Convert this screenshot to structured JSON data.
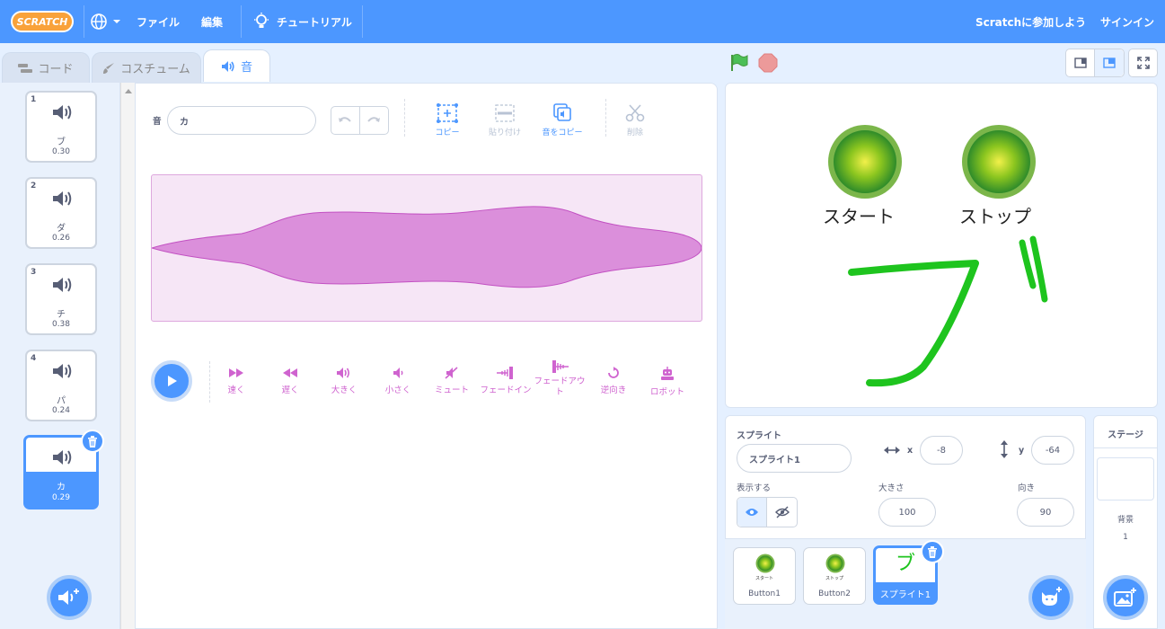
{
  "menubar": {
    "logo": "SCRATCH",
    "file": "ファイル",
    "edit": "編集",
    "tutorials": "チュートリアル",
    "join": "Scratchに参加しよう",
    "signin": "サインイン"
  },
  "tabs": {
    "code": "コード",
    "costumes": "コスチューム",
    "sounds": "音"
  },
  "sounds": [
    {
      "num": "1",
      "name": "ブ",
      "duration": "0.30"
    },
    {
      "num": "2",
      "name": "ダ",
      "duration": "0.26"
    },
    {
      "num": "3",
      "name": "チ",
      "duration": "0.38"
    },
    {
      "num": "4",
      "name": "パ",
      "duration": "0.24"
    },
    {
      "num": "5",
      "name": "カ",
      "duration": "0.29"
    }
  ],
  "editor": {
    "sound_label": "音",
    "sound_name": "カ",
    "tools": {
      "copy": "コピー",
      "paste": "貼り付け",
      "copy_new": "音をコピー",
      "delete": "削除"
    },
    "effects": {
      "faster": "速く",
      "slower": "遅く",
      "louder": "大きく",
      "softer": "小さく",
      "mute": "ミュート",
      "fade_in": "フェードイン",
      "fade_out": "フェードアウト",
      "reverse": "逆向き",
      "robot": "ロボット"
    }
  },
  "stage": {
    "start_label": "スタート",
    "stop_label": "ストップ",
    "drawn_text": "ブ"
  },
  "sprite_info": {
    "sprite_label": "スプライト",
    "sprite_name": "スプライト1",
    "x_label": "x",
    "x": "-8",
    "y_label": "y",
    "y": "-64",
    "show_label": "表示する",
    "size_label": "大きさ",
    "size": "100",
    "direction_label": "向き",
    "direction": "90"
  },
  "sprites": [
    {
      "name": "Button1",
      "caption": "スタート"
    },
    {
      "name": "Button2",
      "caption": "ストップ"
    },
    {
      "name": "スプライト1",
      "caption": "ブ"
    }
  ],
  "stage_panel": {
    "title": "ステージ",
    "backdrops_label": "背景",
    "backdrops_count": "1"
  },
  "colors": {
    "primary": "#4c97ff",
    "sound": "#cf63cf",
    "menubar": "#4c97ff",
    "go": "#4cbf56"
  }
}
